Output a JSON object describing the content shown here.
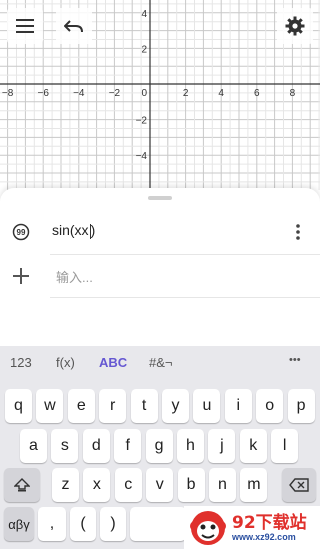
{
  "graph": {
    "x_ticks": [
      "−8",
      "−6",
      "−4",
      "−2",
      "0",
      "2",
      "4",
      "6",
      "8"
    ],
    "y_ticks": [
      "4",
      "2",
      "−2",
      "−4"
    ]
  },
  "toolbar": {
    "menu_icon": "menu-icon",
    "undo_icon": "undo-icon",
    "settings_icon": "gear-icon"
  },
  "algebra": {
    "expression": "sin(xx",
    "closing": ")",
    "input_placeholder": "输入..."
  },
  "keyboard": {
    "tabs": [
      "123",
      "f(x)",
      "ABC",
      "#&¬"
    ],
    "active_tab": "ABC",
    "more_label": "•••",
    "row1": [
      "q",
      "w",
      "e",
      "r",
      "t",
      "y",
      "u",
      "i",
      "o",
      "p"
    ],
    "row2": [
      "a",
      "s",
      "d",
      "f",
      "g",
      "h",
      "j",
      "k",
      "l"
    ],
    "row3": [
      "z",
      "x",
      "c",
      "v",
      "b",
      "n",
      "m"
    ],
    "row4": [
      "αβγ",
      ",",
      "(",
      ")"
    ]
  },
  "watermark": {
    "brand": "92下载站",
    "url": "www.xz92.com"
  },
  "colors": {
    "accent": "#6557d2",
    "watermark_red": "#e0302c"
  }
}
